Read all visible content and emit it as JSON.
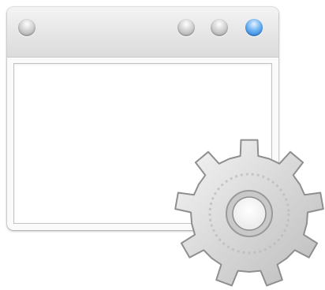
{
  "window": {
    "title": "",
    "buttons": [
      "close",
      "minimize",
      "zoom",
      "maximize"
    ]
  },
  "colors": {
    "button_grey": "#bdbdbd",
    "button_blue": "#2f86e6",
    "gear": "#cfcfcf"
  },
  "icons": [
    "window-icon",
    "gear-icon"
  ]
}
